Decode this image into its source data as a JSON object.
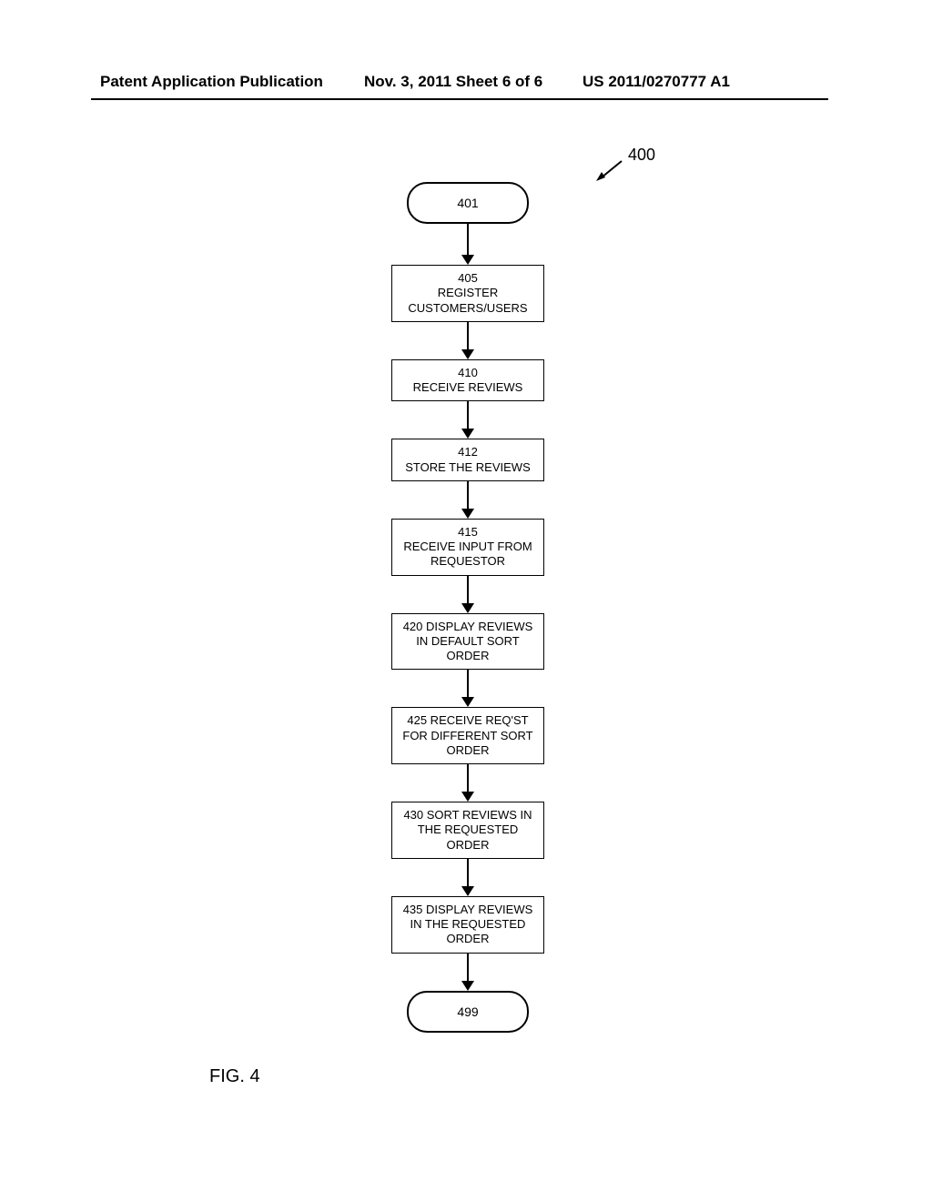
{
  "header": {
    "left": "Patent Application Publication",
    "center": "Nov. 3, 2011  Sheet 6 of 6",
    "right": "US 2011/0270777 A1"
  },
  "ref": "400",
  "figure_label": "FIG. 4",
  "terminals": {
    "start": "401",
    "end": "499"
  },
  "steps": [
    {
      "num": "405",
      "text": "REGISTER CUSTOMERS/USERS"
    },
    {
      "num": "410",
      "text": "RECEIVE REVIEWS"
    },
    {
      "num": "412",
      "text": "STORE THE REVIEWS"
    },
    {
      "num": "415",
      "text": "RECEIVE INPUT FROM REQUESTOR"
    },
    {
      "num": "420",
      "text": "DISPLAY REVIEWS IN DEFAULT SORT ORDER",
      "inline": true
    },
    {
      "num": "425",
      "text": "RECEIVE REQ'ST FOR DIFFERENT SORT ORDER",
      "inline": true
    },
    {
      "num": "430",
      "text": "SORT REVIEWS IN THE REQUESTED ORDER",
      "inline": true
    },
    {
      "num": "435",
      "text": "DISPLAY REVIEWS IN THE REQUESTED ORDER",
      "inline": true
    }
  ]
}
